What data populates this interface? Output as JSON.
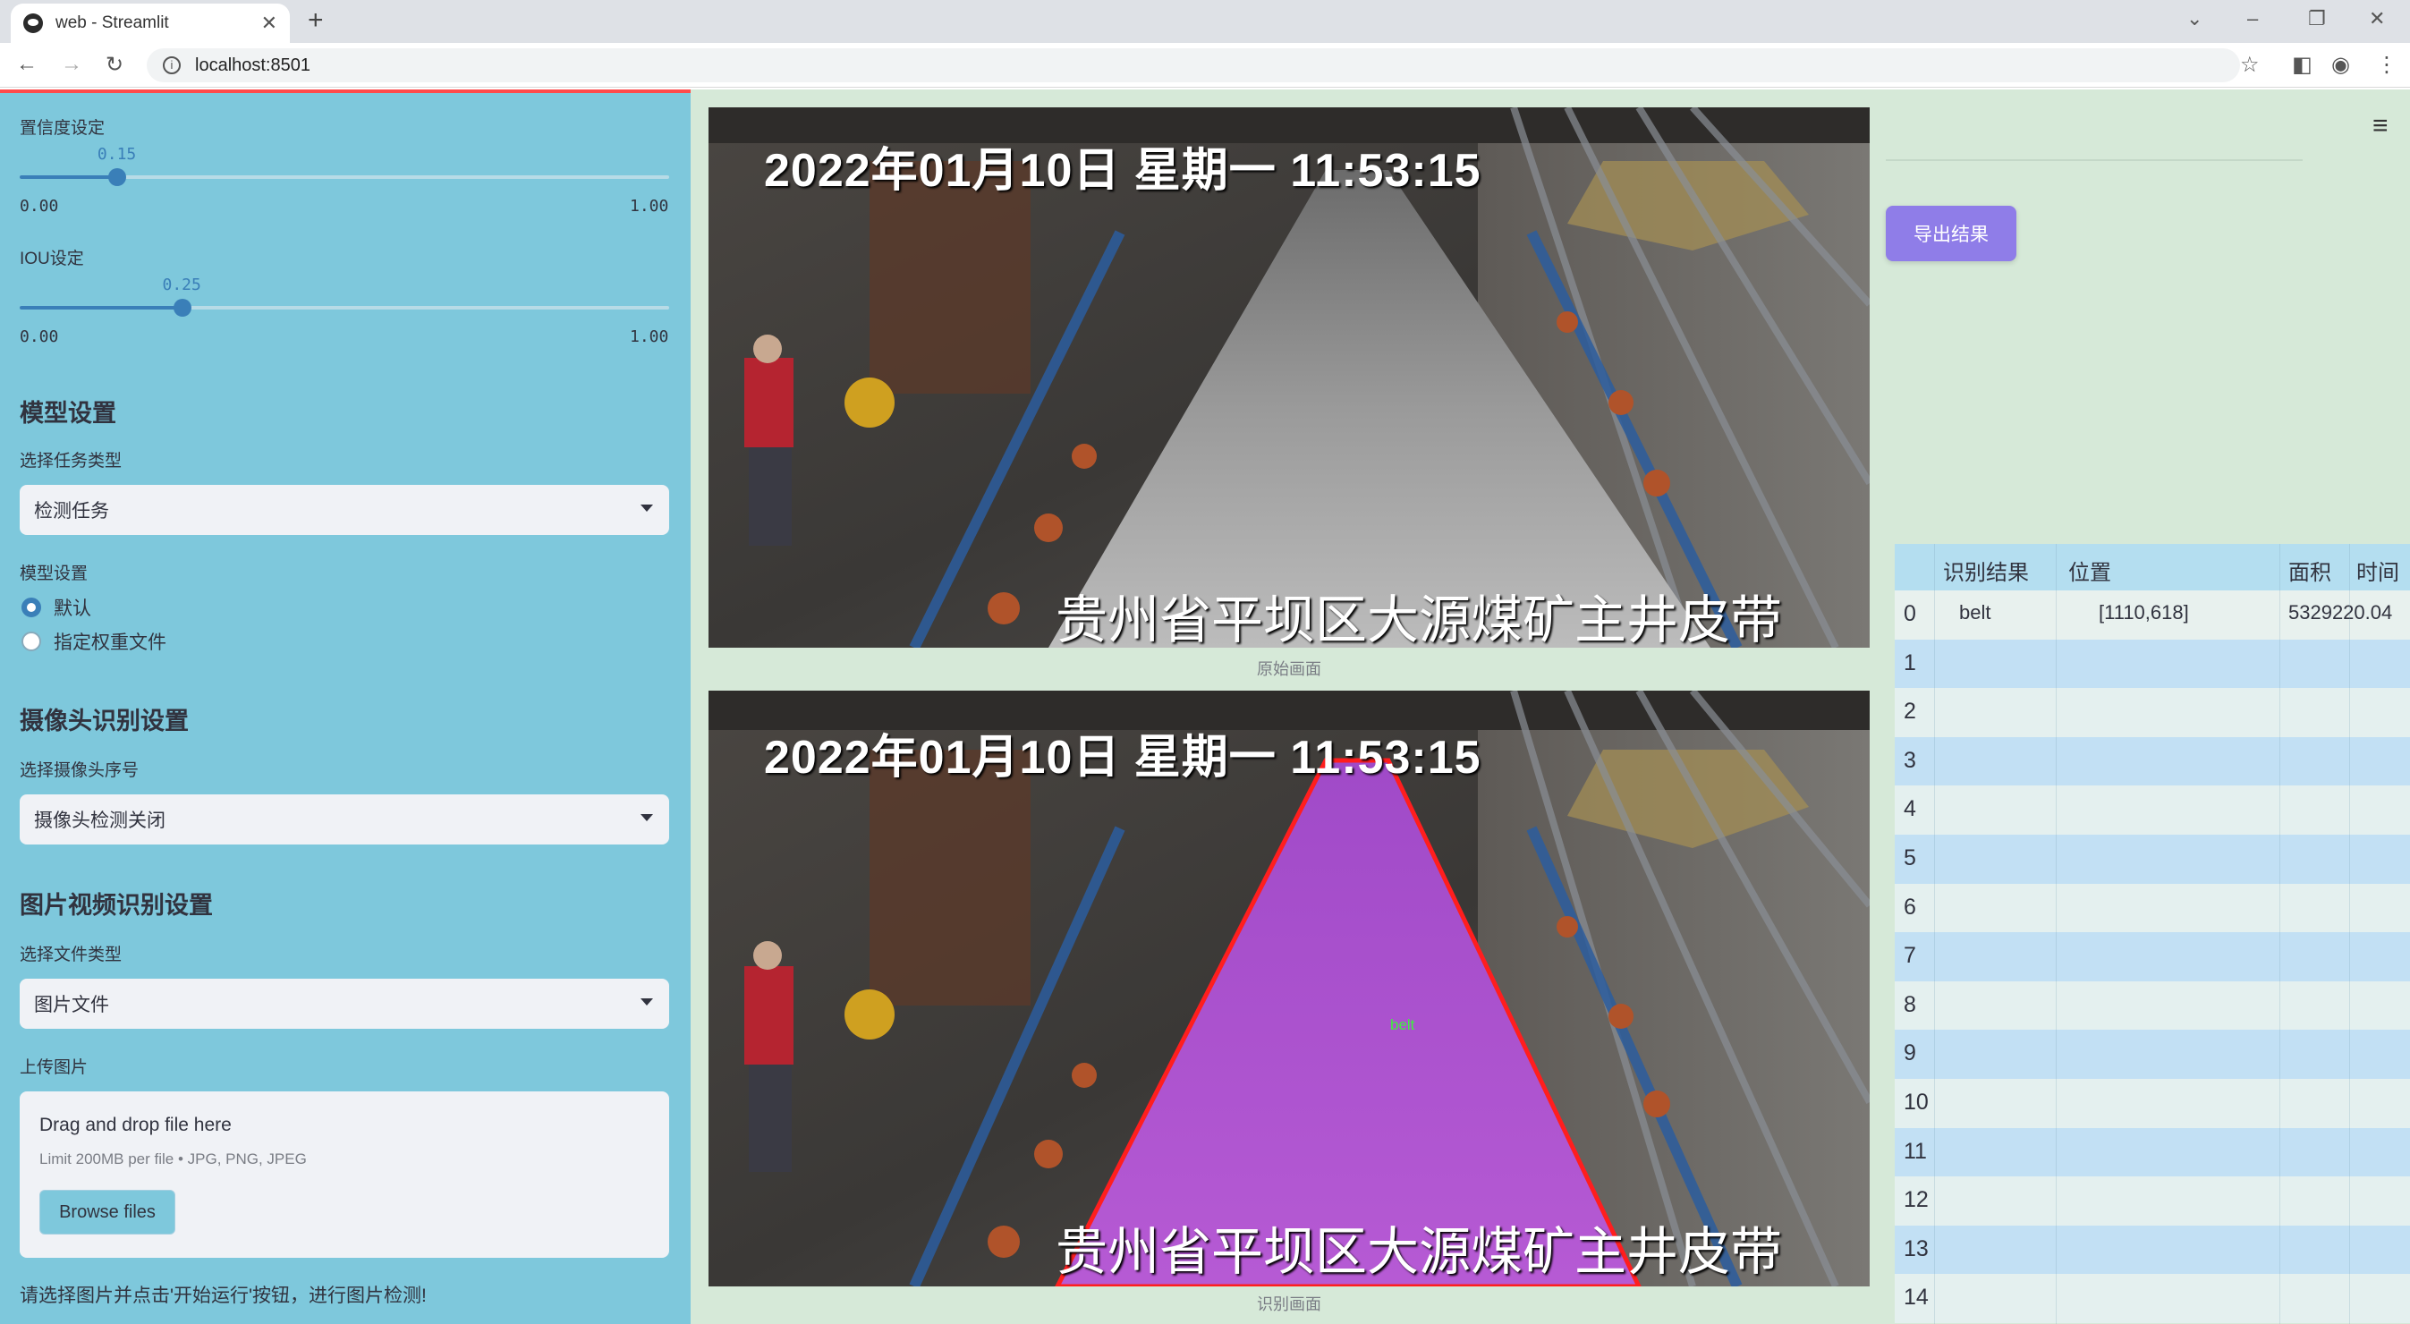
{
  "browser": {
    "tab_title": "web - Streamlit",
    "url": "localhost:8501"
  },
  "sidebar": {
    "confidence": {
      "label": "置信度设定",
      "value": "0.15",
      "min": "0.00",
      "max": "1.00",
      "fraction": 0.15
    },
    "iou": {
      "label": "IOU设定",
      "value": "0.25",
      "min": "0.00",
      "max": "1.00",
      "fraction": 0.25
    },
    "model_section": "模型设置",
    "task_label": "选择任务类型",
    "task_value": "检测任务",
    "model_label": "模型设置",
    "model_options": [
      "默认",
      "指定权重文件"
    ],
    "model_selected": 0,
    "camera_section": "摄像头识别设置",
    "camera_label": "选择摄像头序号",
    "camera_value": "摄像头检测关闭",
    "file_section": "图片视频识别设置",
    "file_type_label": "选择文件类型",
    "file_type_value": "图片文件",
    "upload_label": "上传图片",
    "upload_title": "Drag and drop file here",
    "upload_limit": "Limit 200MB per file • JPG, PNG, JPEG",
    "browse_label": "Browse files",
    "hint": "请选择图片并点击'开始运行'按钮，进行图片检测!"
  },
  "main": {
    "original_caption": "原始画面",
    "result_caption": "识别画面",
    "timestamp_overlay": "2022年01月10日 星期一 11:53:15",
    "location_overlay": "贵州省平坝区大源煤矿主井皮带",
    "detection_label": "belt",
    "export_label": "导出结果"
  },
  "table": {
    "headers": [
      "识别结果",
      "位置",
      "面积",
      "时间"
    ],
    "rows": [
      {
        "index": "0",
        "result": "belt",
        "position": "[1110,618]",
        "area": "5329220.04",
        "time": ""
      },
      {
        "index": "1"
      },
      {
        "index": "2"
      },
      {
        "index": "3"
      },
      {
        "index": "4"
      },
      {
        "index": "5"
      },
      {
        "index": "6"
      },
      {
        "index": "7"
      },
      {
        "index": "8"
      },
      {
        "index": "9"
      },
      {
        "index": "10"
      },
      {
        "index": "11"
      },
      {
        "index": "12"
      },
      {
        "index": "13"
      },
      {
        "index": "14"
      }
    ]
  },
  "colors": {
    "sidebar_bg": "#7ec8dc",
    "main_bg": "#d6e9d8",
    "accent": "#3a7fb8",
    "export_button": "#8f7de8",
    "mask_fill": "#b04bd8",
    "mask_outline": "#ff1e1e"
  }
}
